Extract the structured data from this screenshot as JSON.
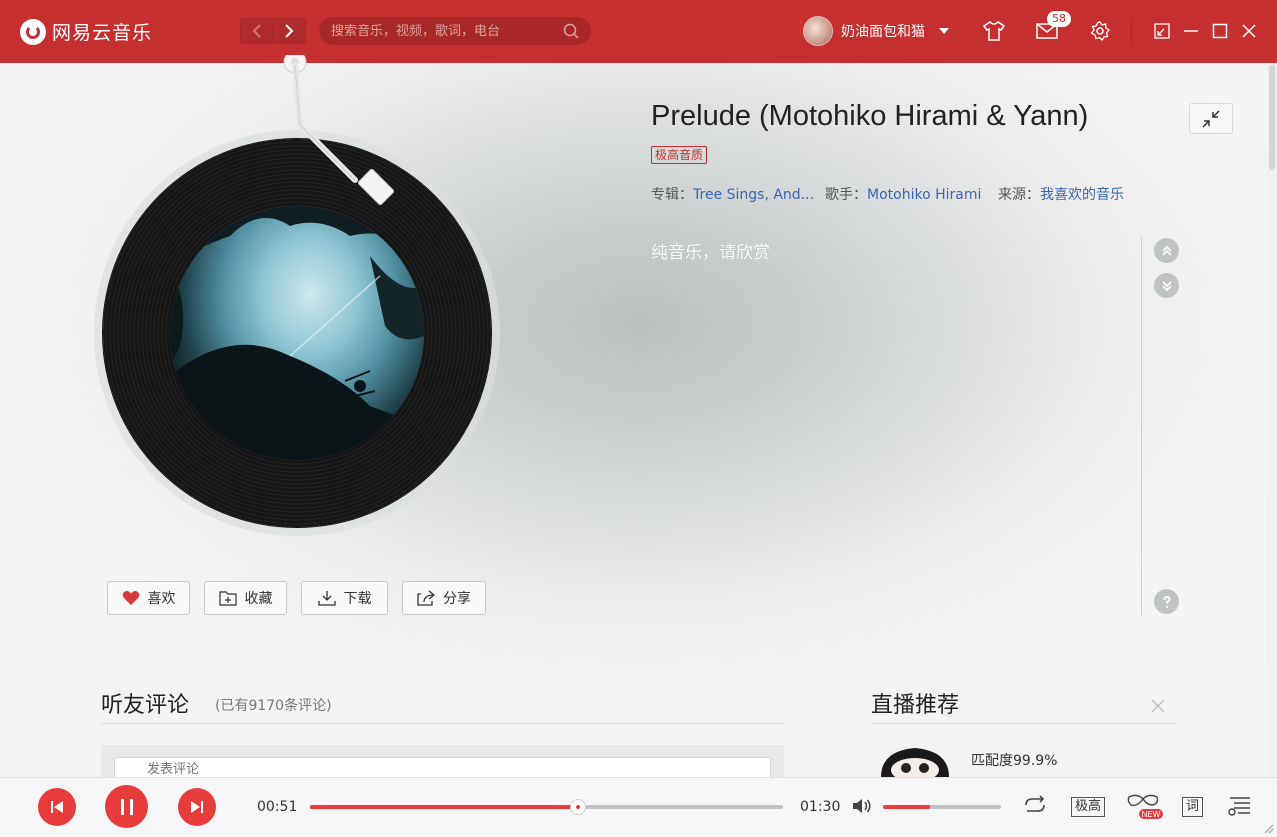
{
  "app": {
    "name": "网易云音乐"
  },
  "search": {
    "placeholder": "搜索音乐，视频，歌词，电台"
  },
  "user": {
    "name": "奶油面包和猫",
    "messages": "58"
  },
  "song": {
    "title": "Prelude (Motohiko Hirami & Yann)",
    "quality": "极高音质",
    "album_label": "专辑：",
    "album": "Tree Sings, And...",
    "artist_label": "歌手：",
    "artist": "Motohiko Hirami",
    "source_label": "来源：",
    "source": "我喜欢的音乐",
    "lyrics": "纯音乐，请欣赏"
  },
  "actions": {
    "like": "喜欢",
    "collect": "收藏",
    "download": "下载",
    "share": "分享"
  },
  "comments": {
    "title": "听友评论",
    "count": "(已有9170条评论)",
    "placeholder": "发表评论"
  },
  "live": {
    "title": "直播推荐",
    "match": "匹配度99.9%"
  },
  "playback": {
    "current": "00:51",
    "total": "01:30",
    "progress": 0.567,
    "volume": 0.4,
    "quality_label": "极高",
    "lyric_label": "词",
    "new_badge": "NEW"
  },
  "colors": {
    "brand": "#c62f2f",
    "accent": "#e83c3c",
    "link": "#3a65b5"
  }
}
